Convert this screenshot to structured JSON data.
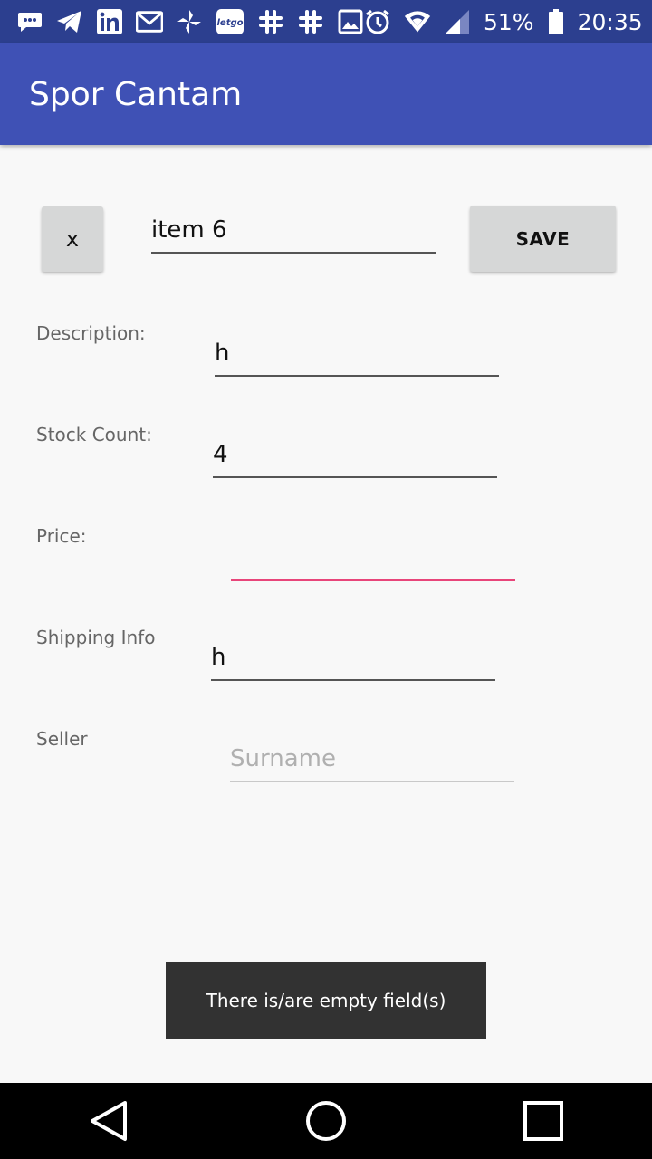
{
  "status_bar": {
    "left_icons": [
      "message-icon",
      "telegram-icon",
      "linkedin-icon",
      "gmail-icon",
      "pinwheel-icon",
      "letgo-icon",
      "slack-icon",
      "slack-icon",
      "gallery-icon"
    ],
    "letgo_text": "letgo",
    "battery_percent": "51%",
    "time": "20:35"
  },
  "app_bar": {
    "title": "Spor Cantam"
  },
  "form": {
    "close_label": "x",
    "save_label": "SAVE",
    "name_value": "item 6",
    "description": {
      "label": "Description:",
      "value": "h"
    },
    "stock_count": {
      "label": "Stock Count:",
      "value": "4"
    },
    "price": {
      "label": "Price:",
      "value": ""
    },
    "shipping_info": {
      "label": "Shipping Info",
      "value": "h"
    },
    "seller": {
      "label": "Seller",
      "placeholder": "Surname"
    }
  },
  "toast": {
    "message": "There is/are empty field(s)"
  },
  "colors": {
    "status_bar": "#2c3f8f",
    "app_bar": "#3f51b5",
    "focus_underline": "#e8457a",
    "toast_bg": "#323232"
  }
}
